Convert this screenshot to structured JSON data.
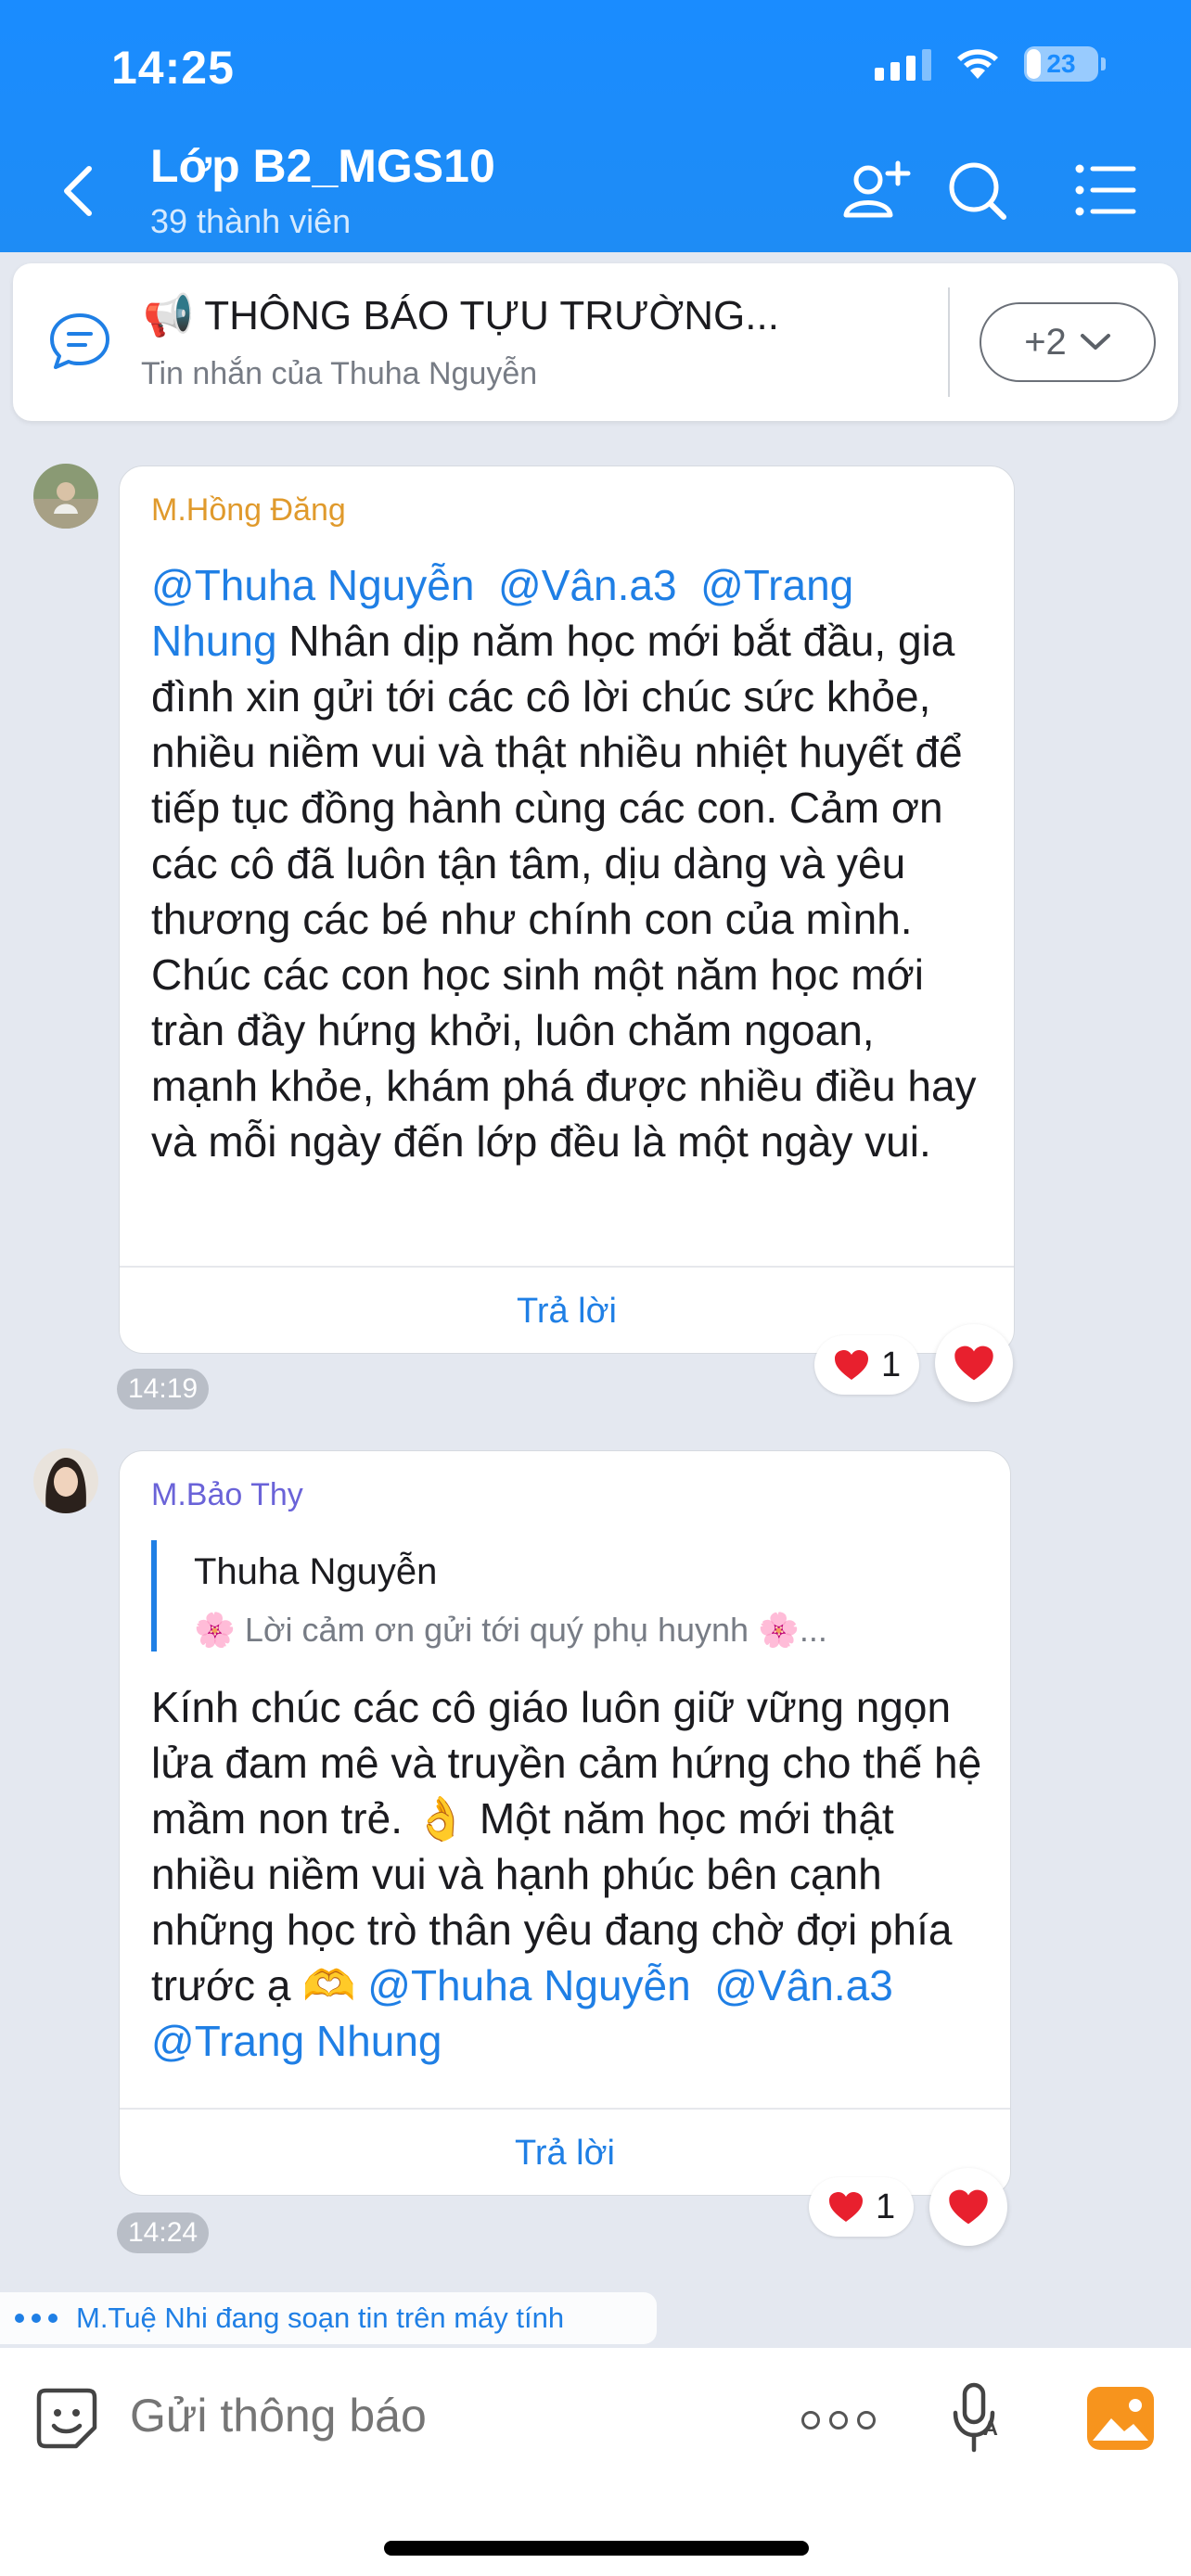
{
  "status": {
    "time": "14:25",
    "battery": "23"
  },
  "header": {
    "title": "Lớp B2_MGS10",
    "subtitle": "39 thành viên"
  },
  "pinned": {
    "title": "📢 THÔNG BÁO TỰU TRƯỜNG...",
    "subtitle": "Tin nhắn của Thuha Nguyễn",
    "more_label": "+2"
  },
  "messages": [
    {
      "sender": "M.Hồng Đăng",
      "sender_color": "#e09a2c",
      "mentions": [
        "@Thuha Nguyễn",
        "@Vân.a3",
        "@Trang",
        "Nhung"
      ],
      "text": " Nhân dịp năm học mới bắt đầu, gia đình xin gửi tới các cô lời chúc sức khỏe, nhiều niềm vui và thật nhiều nhiệt huyết để tiếp tục đồng hành cùng các con. Cảm ơn các cô đã luôn tận tâm, dịu dàng và yêu thương các bé như chính con của mình. Chúc các con học sinh một năm học mới tràn đầy hứng khởi, luôn chăm ngoan, mạnh khỏe, khám phá được nhiều điều hay và mỗi ngày đến lớp đều là một ngày vui.",
      "reply_label": "Trả lời",
      "time": "14:19",
      "reaction_count": "1"
    },
    {
      "sender": "M.Bảo Thy",
      "sender_color": "#6a63d8",
      "quote_name": "Thuha Nguyễn",
      "quote_text": "🌸 Lời cảm ơn gửi tới quý phụ huynh 🌸...",
      "text": "Kính chúc  các cô giáo luôn giữ vững ngọn lửa đam mê và truyền cảm hứng cho thế hệ mầm non trẻ. 👌 Một năm học mới thật nhiều niềm vui và hạnh phúc bên cạnh những học trò thân yêu đang chờ đợi phía trước ạ 🫶 ",
      "mentions": [
        "@Thuha Nguyễn",
        "@Vân.a3",
        "@Trang Nhung"
      ],
      "reply_label": "Trả lời",
      "time": "14:24",
      "reaction_count": "1"
    }
  ],
  "typing": "M.Tuệ Nhi đang soạn tin trên máy tính",
  "composer": {
    "placeholder": "Gửi thông báo"
  },
  "colors": {
    "primary": "#1a8cff",
    "mention": "#1f7fe5",
    "heart": "#e8202e"
  }
}
